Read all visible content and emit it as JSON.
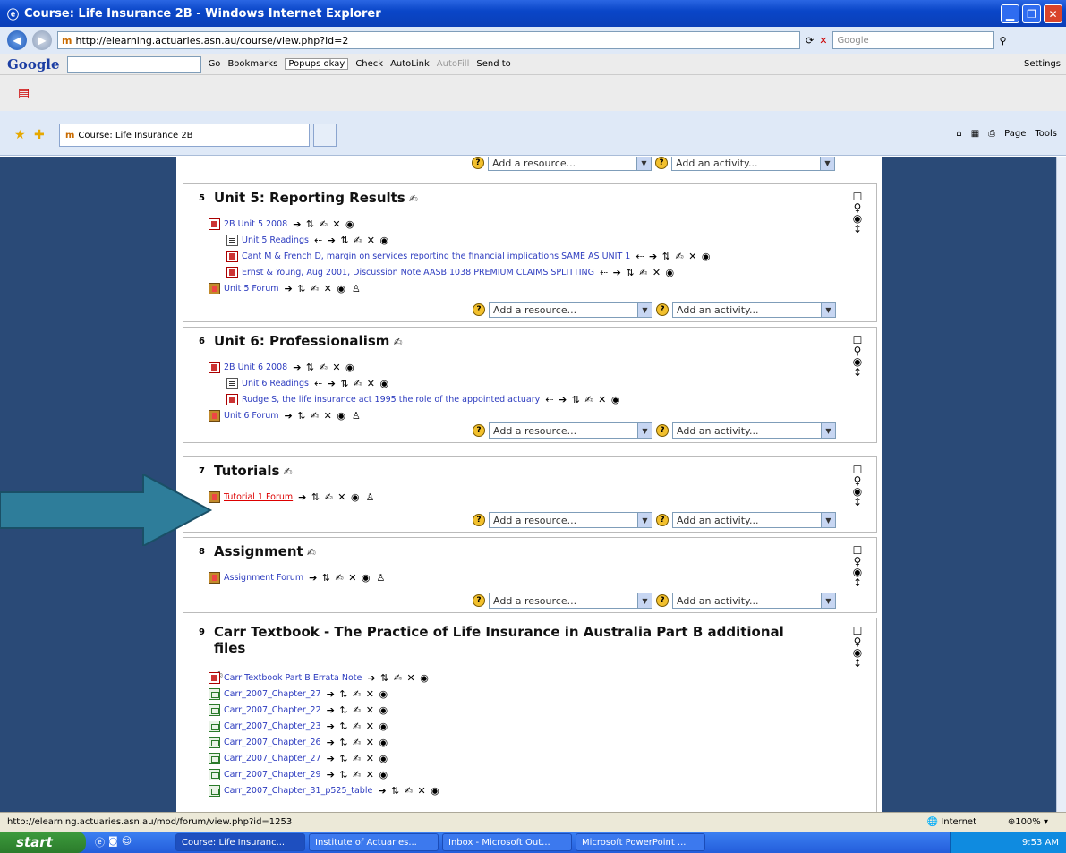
{
  "window": {
    "title": "Course: Life Insurance 2B - Windows Internet Explorer"
  },
  "address": {
    "url": "http://elearning.actuaries.asn.au/course/view.php?id=2",
    "search_placeholder": "Google"
  },
  "google_toolbar": {
    "go": "Go",
    "bookmarks": "Bookmarks",
    "popups": "Popups okay",
    "check": "Check",
    "autolink": "AutoLink",
    "autofill": "AutoFill",
    "sendto": "Send to",
    "settings": "Settings"
  },
  "tab": {
    "label": "Course: Life Insurance 2B",
    "page": "Page",
    "tools": "Tools"
  },
  "selects": {
    "resource": "Add a resource...",
    "activity": "Add an activity..."
  },
  "sections": [
    {
      "num": "5",
      "title": "Unit 5: Reporting Results",
      "items": [
        {
          "icon": "pdf",
          "label": "2B Unit 5 2008",
          "ctrls": "➔ ⇅ ✍ ✕ ◉",
          "indent": 0
        },
        {
          "icon": "doc",
          "label": "Unit 5 Readings",
          "ctrls": "⇠ ➔ ⇅ ✍ ✕ ◉",
          "indent": 1
        },
        {
          "icon": "pdf",
          "label": "Cant M & French D, margin on services reporting the financial implications SAME AS UNIT 1",
          "ctrls": "⇠ ➔ ⇅ ✍ ✕ ◉",
          "indent": 1
        },
        {
          "icon": "pdf",
          "label": "Ernst & Young, Aug 2001, Discussion Note AASB 1038 PREMIUM CLAIMS SPLITTING",
          "ctrls": "⇠ ➔ ⇅ ✍ ✕ ◉",
          "indent": 1
        },
        {
          "icon": "forum",
          "label": "Unit 5 Forum",
          "ctrls": "➔ ⇅ ✍ ✕ ◉",
          "indent": 0,
          "lock": true
        }
      ]
    },
    {
      "num": "6",
      "title": "Unit 6: Professionalism",
      "items": [
        {
          "icon": "pdf",
          "label": "2B Unit 6 2008",
          "ctrls": "➔ ⇅ ✍ ✕ ◉",
          "indent": 0
        },
        {
          "icon": "doc",
          "label": "Unit 6 Readings",
          "ctrls": "⇠ ➔ ⇅ ✍ ✕ ◉",
          "indent": 1
        },
        {
          "icon": "pdf",
          "label": "Rudge S, the life insurance act 1995 the role of the appointed actuary",
          "ctrls": "⇠ ➔ ⇅ ✍ ✕ ◉",
          "indent": 1
        },
        {
          "icon": "forum",
          "label": "Unit 6 Forum",
          "ctrls": "➔ ⇅ ✍ ✕ ◉",
          "indent": 0,
          "lock": true
        }
      ]
    },
    {
      "num": "7",
      "title": "Tutorials",
      "items": [
        {
          "icon": "forum",
          "label": "Tutorial 1 Forum",
          "ctrls": "➔ ⇅ ✍ ✕ ◉",
          "indent": 0,
          "lock": true,
          "hover": true
        }
      ]
    },
    {
      "num": "8",
      "title": "Assignment",
      "items": [
        {
          "icon": "forum",
          "label": "Assignment Forum",
          "ctrls": "➔ ⇅ ✍ ✕ ◉",
          "indent": 0,
          "lock": true
        }
      ]
    },
    {
      "num": "9",
      "title": "Carr Textbook - The Practice of Life Insurance in Australia Part B additional files",
      "items": [
        {
          "icon": "pdf",
          "label": "Carr Textbook Part B Errata Note",
          "ctrls": "➔ ⇅ ✍ ✕ ◉",
          "indent": 0
        },
        {
          "icon": "xls",
          "label": "Carr_2007_Chapter_27",
          "ctrls": "➔ ⇅ ✍ ✕ ◉",
          "indent": 0
        },
        {
          "icon": "xls",
          "label": "Carr_2007_Chapter_22",
          "ctrls": "➔ ⇅ ✍ ✕ ◉",
          "indent": 0
        },
        {
          "icon": "xls",
          "label": "Carr_2007_Chapter_23",
          "ctrls": "➔ ⇅ ✍ ✕ ◉",
          "indent": 0
        },
        {
          "icon": "xls",
          "label": "Carr_2007_Chapter_26",
          "ctrls": "➔ ⇅ ✍ ✕ ◉",
          "indent": 0
        },
        {
          "icon": "xls",
          "label": "Carr_2007_Chapter_27",
          "ctrls": "➔ ⇅ ✍ ✕ ◉",
          "indent": 0
        },
        {
          "icon": "xls",
          "label": "Carr_2007_Chapter_29",
          "ctrls": "➔ ⇅ ✍ ✕ ◉",
          "indent": 0
        },
        {
          "icon": "xls",
          "label": "Carr_2007_Chapter_31_p525_table",
          "ctrls": "➔ ⇅ ✍ ✕ ◉",
          "indent": 0
        }
      ]
    }
  ],
  "status": {
    "url": "http://elearning.actuaries.asn.au/mod/forum/view.php?id=1253",
    "zone": "Internet",
    "zoom": "100%"
  },
  "taskbar": {
    "start": "start",
    "items": [
      "Course: Life Insuranc...",
      "Institute of Actuaries...",
      "Inbox - Microsoft Out...",
      "Microsoft PowerPoint ..."
    ],
    "time": "9:53 AM"
  }
}
